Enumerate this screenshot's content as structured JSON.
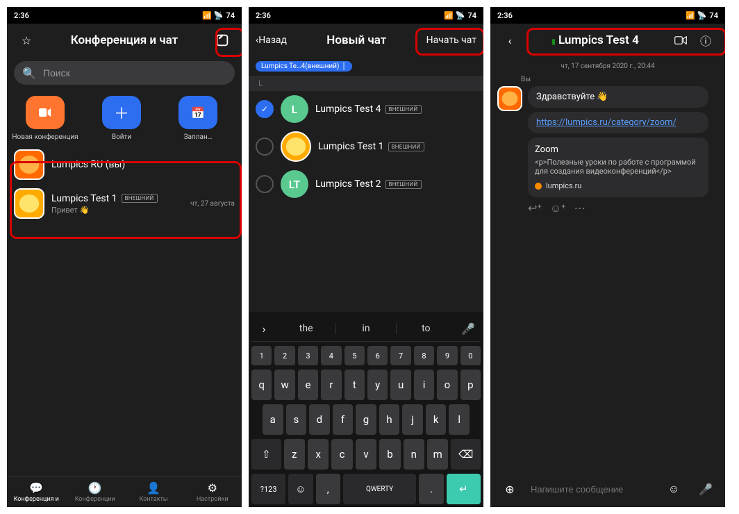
{
  "status": {
    "time": "2:36",
    "battery": "74"
  },
  "s1": {
    "title": "Конференция и чат",
    "search_ph": "Поиск",
    "actions": [
      {
        "label": "Новая конференция",
        "color": "#ff742e"
      },
      {
        "label": "Войти",
        "color": "#2d6ef0"
      },
      {
        "label": "Заплан…",
        "color": "#2d6ef0"
      }
    ],
    "chats": [
      {
        "name": "Lumpics RU (вы)",
        "sub": "",
        "date": ""
      },
      {
        "name": "Lumpics Test 1",
        "badge": "ВНЕШНИЙ",
        "sub": "Привет 👋",
        "date": "чт, 27 августа"
      }
    ],
    "tabs": [
      "Конференция и",
      "Конференции",
      "Контакты",
      "Настройки"
    ]
  },
  "s2": {
    "back": "Назад",
    "title": "Новый чат",
    "start": "Начать чат",
    "chip": "Lumpics Te…4(внешний)",
    "letter": "L",
    "contacts": [
      {
        "name": "Lumpics  Test 4",
        "badge": "ВНЕШНИЙ",
        "av": "L",
        "col": "#59c98f",
        "sel": true
      },
      {
        "name": "Lumpics Test 1",
        "badge": "ВНЕШНИЙ",
        "av": "",
        "col": "yellow",
        "sel": false
      },
      {
        "name": "Lumpics Test 2",
        "badge": "ВНЕШНИЙ",
        "av": "LT",
        "col": "#59c98f",
        "sel": false
      }
    ],
    "sugg": [
      "the",
      "in",
      "to"
    ],
    "krows": [
      [
        "1",
        "2",
        "3",
        "4",
        "5",
        "6",
        "7",
        "8",
        "9",
        "0"
      ],
      [
        "q",
        "w",
        "e",
        "r",
        "t",
        "y",
        "u",
        "i",
        "o",
        "p"
      ],
      [
        "a",
        "s",
        "d",
        "f",
        "g",
        "h",
        "j",
        "k",
        "l"
      ],
      [
        "⇧",
        "z",
        "x",
        "c",
        "v",
        "b",
        "n",
        "m",
        "⌫"
      ],
      [
        "?123",
        "☺",
        ",",
        "QWERTY",
        ".",
        "↵"
      ]
    ]
  },
  "s3": {
    "title": "Lumpics  Test 4",
    "date": "чт, 17 сентября 2020 г., 20:44",
    "sender": "Вы",
    "m1": "Здравствуйте 👋",
    "link": "https://lumpics.ru/category/zoom/",
    "card_title": "Zoom",
    "card_body": "<p>Полезные уроки по работе с программой для создания видеоконференций</p>",
    "card_site": "lumpics.ru",
    "input_ph": "Напишите сообщение"
  }
}
